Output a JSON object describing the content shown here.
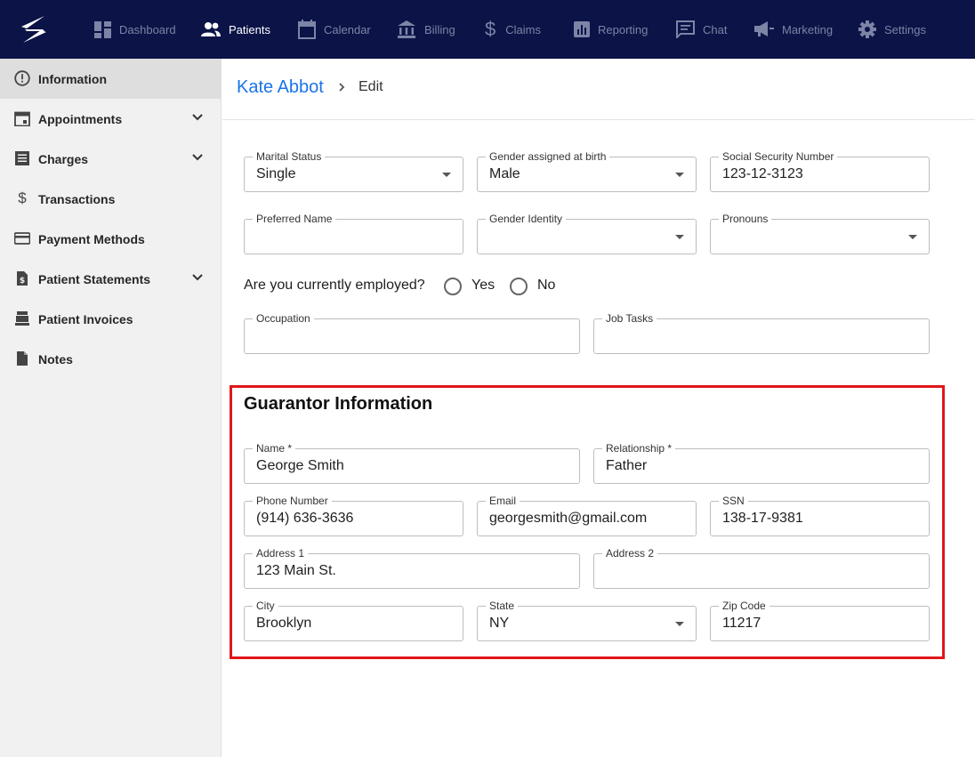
{
  "nav": {
    "items": [
      {
        "label": "Dashboard",
        "icon": "dashboard-icon"
      },
      {
        "label": "Patients",
        "icon": "patients-icon"
      },
      {
        "label": "Calendar",
        "icon": "calendar-icon"
      },
      {
        "label": "Billing",
        "icon": "billing-icon"
      },
      {
        "label": "Claims",
        "icon": "dollar-icon"
      },
      {
        "label": "Reporting",
        "icon": "reporting-icon"
      },
      {
        "label": "Chat",
        "icon": "chat-icon"
      },
      {
        "label": "Marketing",
        "icon": "megaphone-icon"
      },
      {
        "label": "Settings",
        "icon": "gear-icon"
      }
    ]
  },
  "sidebar": {
    "items": [
      {
        "label": "Information",
        "icon": "info-icon"
      },
      {
        "label": "Appointments",
        "icon": "calendar-icon"
      },
      {
        "label": "Charges",
        "icon": "list-icon"
      },
      {
        "label": "Transactions",
        "icon": "dollar-icon"
      },
      {
        "label": "Payment Methods",
        "icon": "credit-card-icon"
      },
      {
        "label": "Patient Statements",
        "icon": "statement-icon"
      },
      {
        "label": "Patient Invoices",
        "icon": "register-icon"
      },
      {
        "label": "Notes",
        "icon": "document-icon"
      }
    ]
  },
  "header": {
    "patient_name": "Kate Abbot",
    "current": "Edit"
  },
  "form": {
    "marital_status": {
      "label": "Marital Status",
      "value": "Single"
    },
    "gender_birth": {
      "label": "Gender assigned at birth",
      "value": "Male"
    },
    "ssn": {
      "label": "Social Security Number",
      "value": "123-12-3123"
    },
    "preferred_name": {
      "label": "Preferred Name",
      "value": ""
    },
    "gender_identity": {
      "label": "Gender Identity",
      "value": ""
    },
    "pronouns": {
      "label": "Pronouns",
      "value": ""
    },
    "employed_question": "Are you currently employed?",
    "employed_yes": "Yes",
    "employed_no": "No",
    "occupation": {
      "label": "Occupation",
      "value": ""
    },
    "job_tasks": {
      "label": "Job Tasks",
      "value": ""
    }
  },
  "guarantor": {
    "title": "Guarantor Information",
    "name": {
      "label": "Name *",
      "value": "George Smith"
    },
    "relationship": {
      "label": "Relationship *",
      "value": "Father"
    },
    "phone": {
      "label": "Phone Number",
      "value": "(914) 636-3636"
    },
    "email": {
      "label": "Email",
      "value": "georgesmith@gmail.com"
    },
    "ssn": {
      "label": "SSN",
      "value": "138-17-9381"
    },
    "address1": {
      "label": "Address 1",
      "value": "123 Main St."
    },
    "address2": {
      "label": "Address 2",
      "value": ""
    },
    "city": {
      "label": "City",
      "value": "Brooklyn"
    },
    "state": {
      "label": "State",
      "value": "NY"
    },
    "zip": {
      "label": "Zip Code",
      "value": "11217"
    }
  },
  "colors": {
    "nav_bg": "#0b1347",
    "accent": "#1a73e8",
    "highlight": "#e0161b"
  }
}
